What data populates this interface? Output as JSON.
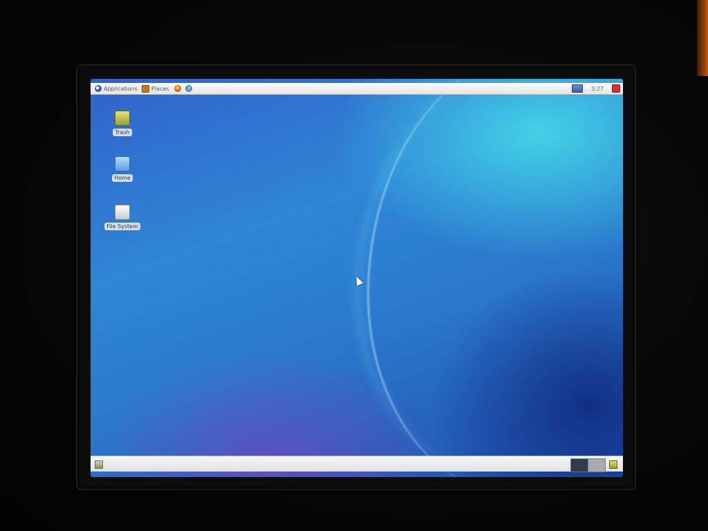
{
  "top_panel": {
    "applications_label": "Applications",
    "places_label": "Places",
    "clock": "3:27"
  },
  "desktop_icons": [
    {
      "label": "Trash",
      "icon": "trash-icon"
    },
    {
      "label": "Home",
      "icon": "folder-home-icon"
    },
    {
      "label": "File System",
      "icon": "drive-icon"
    }
  ],
  "bottom_panel": {
    "workspaces": [
      "workspace-1",
      "workspace-2"
    ]
  },
  "colors": {
    "panel": "#f2f2f2",
    "wallpaper_dark": "#1f4cae",
    "wallpaper_light": "#48ebeb",
    "wallpaper_purple": "#8c3cbe"
  }
}
